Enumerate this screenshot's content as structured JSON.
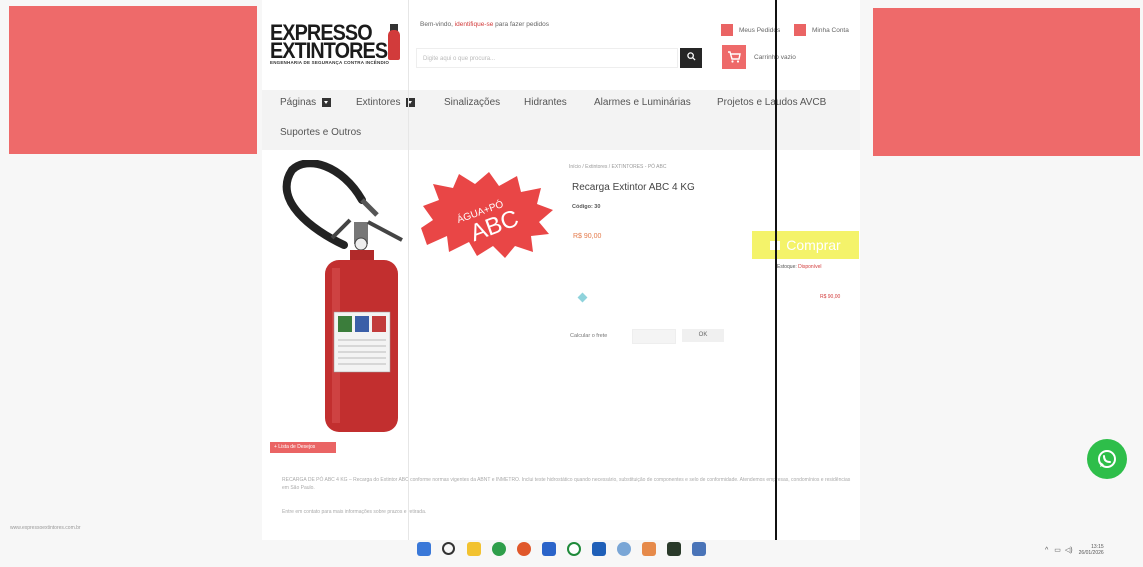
{
  "site": {
    "logo_line1": "EXPRESSO",
    "logo_line2": "EXTINTORES",
    "logo_tagline": "ENGENHARIA DE SEGURANÇA CONTRA INCÊNDIO",
    "welcome_prefix": "Bem-vindo, ",
    "welcome_link": "identifique-se",
    "welcome_suffix": " para fazer pedidos",
    "search_placeholder": "Digite aqui o que procura...",
    "my_orders": "Meus Pedidos",
    "my_account": "Minha Conta",
    "cart_label": "Carrinho vazio"
  },
  "nav": [
    {
      "label": "Páginas",
      "dropdown": true
    },
    {
      "label": "Extintores",
      "dropdown": true
    },
    {
      "label": "Sinalizações",
      "dropdown": false
    },
    {
      "label": "Hidrantes",
      "dropdown": false
    },
    {
      "label": "Alarmes e Luminárias",
      "dropdown": false
    },
    {
      "label": "Projetos e Laudos AVCB",
      "dropdown": false
    },
    {
      "label": "Suportes e Outros",
      "dropdown": false
    }
  ],
  "product": {
    "breadcrumb": "Início / Extintores / EXTINTORES - PÓ ABC",
    "title": "Recarga Extintor ABC 4 KG",
    "code": "Código: 30",
    "price": "R$ 90,00",
    "buy_label": "Comprar",
    "stock_label": "Estoque: ",
    "stock_value": "Disponível",
    "option_price": "R$ 90,00",
    "calc_label": "Calcular o frete",
    "calc_button": "OK",
    "burst_line1": "ÁGUA+PÓ",
    "burst_line2": "ABC",
    "list_button": "+ Lista de Desejos",
    "description": "RECARGA DE PÓ ABC 4 KG – Recarga do Extintor ABC conforme normas vigentes da ABNT e INMETRO. Inclui teste hidrostático quando necessário, substituição de componentes e selo de conformidade. Atendemos empresas, condomínios e residências em São Paulo.",
    "description2": "Entre em contato para mais informações sobre prazos e retirada."
  },
  "footer_url": "www.expressoextintores.com.br",
  "tray": {
    "time": "13:15",
    "date": "26/01/2026"
  },
  "colors": {
    "banner": "#ee6a6a",
    "accent_red": "#d23b3b",
    "buy_yellow": "#f4f36a",
    "whatsapp_green": "#2ebe4a"
  },
  "taskbar_icons": [
    "windows-icon",
    "search-icon",
    "file-explorer-icon",
    "chrome-icon",
    "store-icon",
    "mail-icon",
    "whatsapp-icon",
    "calendar-icon",
    "photos-icon",
    "settings-icon",
    "terminal-icon",
    "app-icon"
  ]
}
